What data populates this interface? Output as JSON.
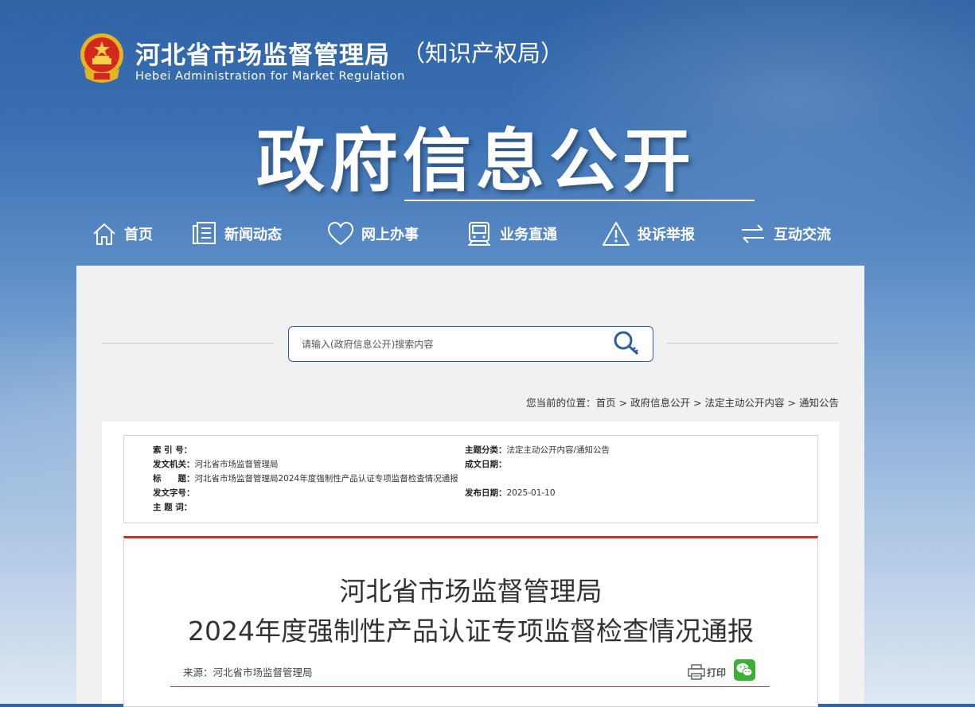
{
  "header": {
    "title_cn": "河北省市场监督管理局",
    "title_suffix": "（知识产权局）",
    "title_en": "Hebei Administration for Market Regulation",
    "hero": "政府信息公开"
  },
  "nav": [
    {
      "label": "首页",
      "icon": "home-icon"
    },
    {
      "label": "新闻动态",
      "icon": "news-icon"
    },
    {
      "label": "网上办事",
      "icon": "heart-icon"
    },
    {
      "label": "业务直通",
      "icon": "train-icon"
    },
    {
      "label": "投诉举报",
      "icon": "warning-icon"
    },
    {
      "label": "互动交流",
      "icon": "exchange-icon"
    }
  ],
  "search": {
    "placeholder": "请输入(政府信息公开)搜索内容",
    "icon": "search-icon"
  },
  "breadcrumb": {
    "prefix": "您当前的位置：",
    "items": [
      "首页",
      "政府信息公开",
      "法定主动公开内容",
      "通知公告"
    ],
    "sep": " > "
  },
  "meta": {
    "index_label": "索 引 号：",
    "index_value": "",
    "topic_label": "主题分类：",
    "topic_value": "法定主动公开内容/通知公告",
    "issuer_label": "发文机关：",
    "issuer_value": "河北省市场监督管理局",
    "created_label": "成文日期：",
    "created_value": "",
    "title_label": "标　　题：",
    "title_value": "河北省市场监督管理局2024年度强制性产品认证专项监督检查情况通报",
    "docno_label": "发文字号：",
    "docno_value": "",
    "published_label": "发布日期：",
    "published_value": "2025-01-10",
    "keywords_label": "主 题 词：",
    "keywords_value": ""
  },
  "article": {
    "title_line1": "河北省市场监督管理局",
    "title_line2": "2024年度强制性产品认证专项监督检查情况通报",
    "source": "来源：河北省市场监督管理局",
    "print_label": "打印"
  },
  "colors": {
    "accent_red": "#c9312b",
    "brand_blue": "#2e5d9e",
    "wechat_green": "#3caf35"
  }
}
